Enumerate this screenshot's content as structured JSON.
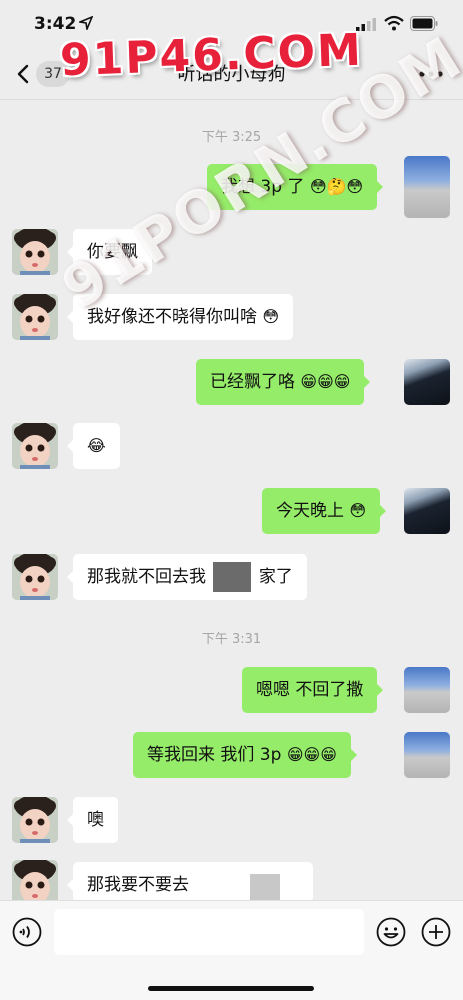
{
  "status_bar": {
    "time": "3:42"
  },
  "nav": {
    "unread_count": "37",
    "title": "听话的小母狗"
  },
  "watermarks": {
    "top": "91P46.COM",
    "diagonal": "91PORN.COM"
  },
  "messages": [
    {
      "type": "timestamp",
      "text": "下午 3:25"
    },
    {
      "type": "out",
      "text": "我想 3p 了",
      "emoji": "😳🤔😳"
    },
    {
      "type": "in",
      "text": "你要飘"
    },
    {
      "type": "in",
      "text": "我好像还不晓得你叫啥",
      "emoji": "😳"
    },
    {
      "type": "out",
      "text": "已经飘了咯",
      "emoji": "😁😁😁"
    },
    {
      "type": "in",
      "text": "",
      "emoji": "😂"
    },
    {
      "type": "out",
      "text": "今天晚上",
      "emoji": "😳"
    },
    {
      "type": "in",
      "text": "那我就不回去我",
      "text2": "家了"
    },
    {
      "type": "timestamp",
      "text": "下午 3:31"
    },
    {
      "type": "out",
      "text": "嗯嗯 不回了撒"
    },
    {
      "type": "out",
      "text": "等我回来 我们 3p",
      "emoji": "😁😁😁"
    },
    {
      "type": "in",
      "text": "噢"
    },
    {
      "type": "in",
      "text": "那我要不要去"
    }
  ],
  "input": {
    "placeholder": ""
  }
}
